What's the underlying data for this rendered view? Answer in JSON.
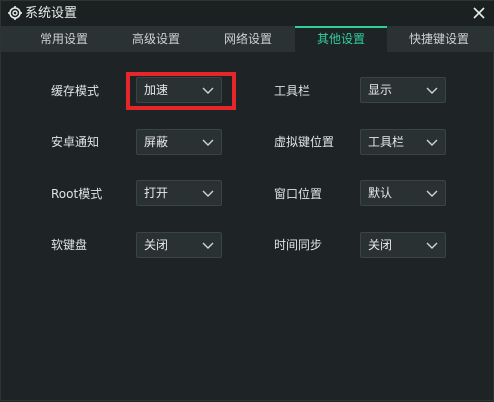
{
  "window": {
    "title": "系统设置"
  },
  "tabs": [
    {
      "label": "常用设置"
    },
    {
      "label": "高级设置"
    },
    {
      "label": "网络设置"
    },
    {
      "label": "其他设置"
    },
    {
      "label": "快捷键设置"
    }
  ],
  "settings": {
    "cache_mode": {
      "label": "缓存模式",
      "value": "加速"
    },
    "toolbar": {
      "label": "工具栏",
      "value": "显示"
    },
    "notifications": {
      "label": "安卓通知",
      "value": "屏蔽"
    },
    "virtual_keys": {
      "label": "虚拟键位置",
      "value": "工具栏"
    },
    "root_mode": {
      "label": "Root模式",
      "value": "打开"
    },
    "window_position": {
      "label": "窗口位置",
      "value": "默认"
    },
    "soft_keyboard": {
      "label": "软键盘",
      "value": "关闭"
    },
    "time_sync": {
      "label": "时间同步",
      "value": "关闭"
    }
  },
  "colors": {
    "accent": "#2fcf9b",
    "highlight": "#e5262b",
    "background": "#1e2425"
  }
}
